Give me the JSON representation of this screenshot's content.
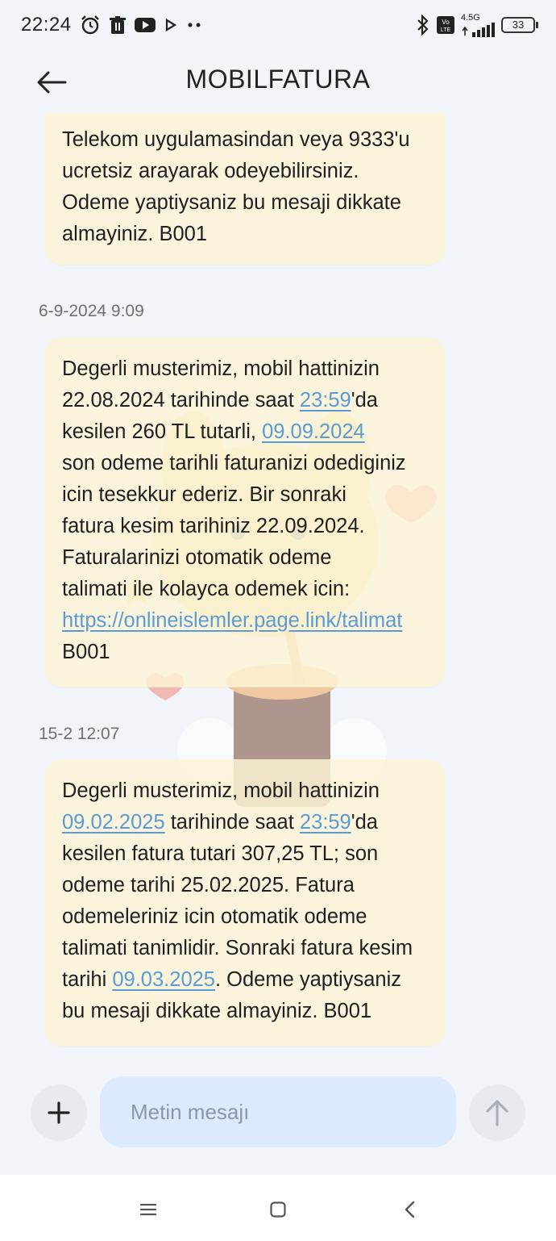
{
  "status_bar": {
    "time": "22:24",
    "network": "4.5G",
    "volte": "Vo LTE",
    "battery": "33",
    "icons": [
      "alarm-icon",
      "trash-icon",
      "youtube-icon",
      "play-icon",
      "more-dots-icon",
      "bluetooth-icon",
      "signal-icon",
      "battery-icon"
    ]
  },
  "header": {
    "title": "MOBILFATURA",
    "back_icon": "arrow-left-icon"
  },
  "messages": [
    {
      "timestamp": "",
      "lines": [
        [
          {
            "t": "Telekom uygulamasindan veya 9333'u"
          }
        ],
        [
          {
            "t": "ucretsiz arayarak odeyebilirsiniz."
          }
        ],
        [
          {
            "t": "Odeme yaptiysaniz bu mesaji dikkate"
          }
        ],
        [
          {
            "t": "almayiniz. B001"
          }
        ]
      ]
    },
    {
      "timestamp": "6-9-2024 9:09",
      "lines": [
        [
          {
            "t": "Degerli musterimiz, mobil hattinizin"
          }
        ],
        [
          {
            "t": "22.08.2024 tarihinde saat "
          },
          {
            "t": "23:59",
            "link": true
          },
          {
            "t": "'da"
          }
        ],
        [
          {
            "t": "kesilen 260 TL tutarli, "
          },
          {
            "t": "09.09.2024",
            "link": true
          }
        ],
        [
          {
            "t": "son odeme tarihli faturanizi odediginiz"
          }
        ],
        [
          {
            "t": "icin tesekkur ederiz. Bir sonraki"
          }
        ],
        [
          {
            "t": "fatura kesim tarihiniz 22.09.2024."
          }
        ],
        [
          {
            "t": "Faturalarinizi otomatik odeme"
          }
        ],
        [
          {
            "t": "talimati ile kolayca odemek icin:"
          }
        ],
        [
          {
            "t": "https://onlineislemler.page.link/talimat",
            "link": true
          }
        ],
        [
          {
            "t": "B001"
          }
        ]
      ]
    },
    {
      "timestamp": "15-2 12:07",
      "lines": [
        [
          {
            "t": "Degerli musterimiz, mobil hattinizin"
          }
        ],
        [
          {
            "t": "09.02.2025",
            "link": true
          },
          {
            "t": " tarihinde saat "
          },
          {
            "t": "23:59",
            "link": true
          },
          {
            "t": "'da"
          }
        ],
        [
          {
            "t": "kesilen fatura tutari 307,25 TL; son"
          }
        ],
        [
          {
            "t": "odeme tarihi 25.02.2025. Fatura"
          }
        ],
        [
          {
            "t": "odemeleriniz icin otomatik odeme"
          }
        ],
        [
          {
            "t": "talimati tanimlidir. Sonraki fatura kesim"
          }
        ],
        [
          {
            "t": "tarihi "
          },
          {
            "t": "09.03.2025",
            "link": true
          },
          {
            "t": ". Odeme yaptiysaniz"
          }
        ],
        [
          {
            "t": "bu mesaji dikkate almayiniz. B001"
          }
        ]
      ]
    }
  ],
  "compose": {
    "placeholder": "Metin mesajı",
    "add_icon": "plus-icon",
    "send_icon": "arrow-up-icon"
  },
  "nav": {
    "icons": [
      "menu-icon",
      "home-square-icon",
      "back-chevron-icon"
    ]
  },
  "colors": {
    "background": "#f1f4f9",
    "bubble": "#fcf4d6",
    "link": "#5b9bd5",
    "input": "#dbeafc"
  }
}
